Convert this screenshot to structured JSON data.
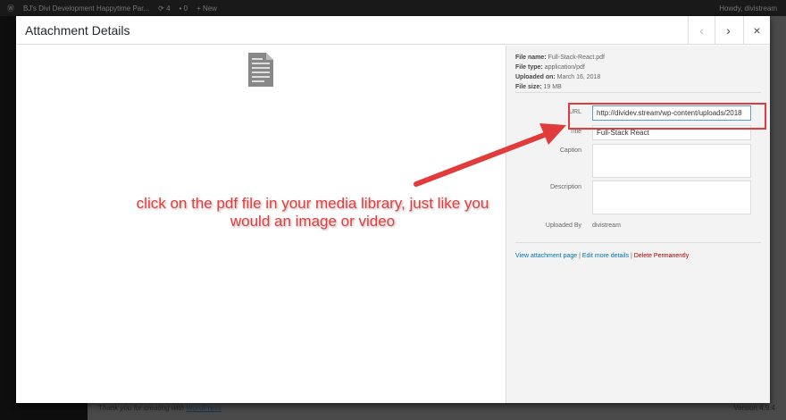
{
  "adminbar": {
    "site": "BJ's Divi Development Happytime Par...",
    "updates": "4",
    "comments": "0",
    "new": "+ New",
    "howdy": "Howdy, divistream"
  },
  "footer": {
    "thanks": "Thank you for creating with ",
    "link": "WordPress",
    "version": "Version 4.9.4"
  },
  "modal": {
    "title": "Attachment Details",
    "prev": "‹",
    "next": "›",
    "close": "×"
  },
  "meta": {
    "file_name_label": "File name:",
    "file_name": "Full-Stack-React.pdf",
    "file_type_label": "File type:",
    "file_type": "application/pdf",
    "uploaded_label": "Uploaded on:",
    "uploaded": "March 16, 2018",
    "size_label": "File size:",
    "size": "19 MB"
  },
  "fields": {
    "url_label": "URL",
    "url": "http://dividev.stream/wp-content/uploads/2018",
    "title_label": "Title",
    "title": "Full-Stack React",
    "caption_label": "Caption",
    "caption": "",
    "description_label": "Description",
    "description": "",
    "uploaded_by_label": "Uploaded By",
    "uploaded_by": "divistream"
  },
  "links": {
    "view": "View attachment page",
    "edit": "Edit more details",
    "delete": "Delete Permanently",
    "sep": " | "
  },
  "annotation": {
    "text": "click on the pdf file in your media library, just like you would an image or video",
    "color": "#e23b3b"
  }
}
